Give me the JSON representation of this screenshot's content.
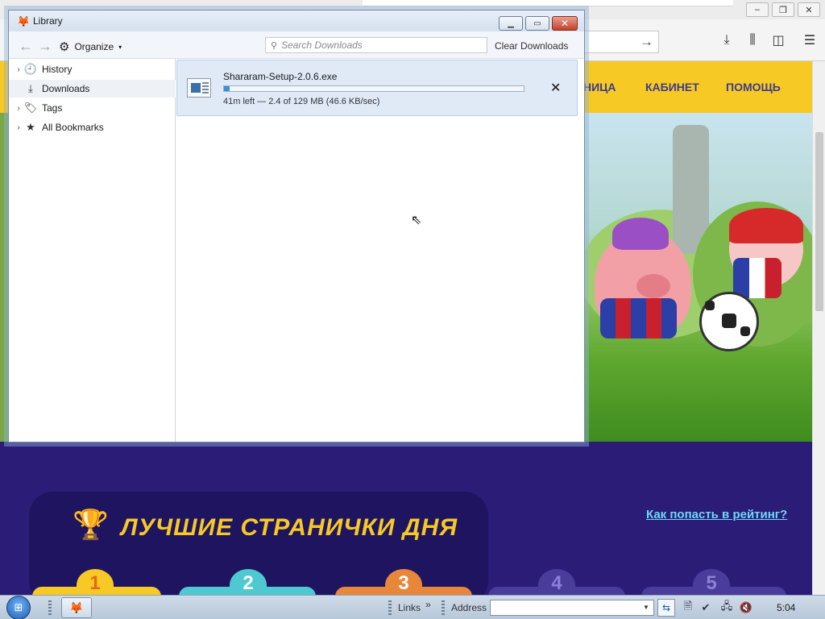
{
  "background_site": {
    "nav": [
      "НИЦА",
      "КАБИНЕТ",
      "ПОМОЩЬ"
    ],
    "rating_title": "ЛУЧШИЕ СТРАНИЧКИ ДНЯ",
    "rating_link": "Как попасть в рейтинг?",
    "places": [
      "1",
      "2",
      "3",
      "4",
      "5"
    ]
  },
  "library": {
    "title": "Library",
    "organize_label": "Organize",
    "search_placeholder": "Search Downloads",
    "clear_label": "Clear Downloads",
    "sidebar": [
      {
        "label": "History",
        "icon": "clock-icon",
        "expandable": true
      },
      {
        "label": "Downloads",
        "icon": "download-icon",
        "expandable": false,
        "selected": true
      },
      {
        "label": "Tags",
        "icon": "tag-icon",
        "expandable": true
      },
      {
        "label": "All Bookmarks",
        "icon": "star-icon",
        "expandable": true
      }
    ],
    "download": {
      "filename": "Shararam-Setup-2.0.6.exe",
      "status": "41m left — 2.4 of 129 MB (46.6 KB/sec)",
      "progress_fraction": 0.019
    }
  },
  "taskbar": {
    "links_label": "Links",
    "links_chevron": "»",
    "address_label": "Address",
    "address_value": "",
    "clock": "5:04"
  },
  "colors": {
    "site_nav_bg": "#f7c924",
    "site_nav_text": "#3a3c8c",
    "rating_bg": "#2b1c78",
    "rating_title": "#f7c924",
    "rating_link": "#6ed8f5",
    "progress_fill": "#3b8fd9",
    "download_item_bg": "#dfeaf6"
  }
}
